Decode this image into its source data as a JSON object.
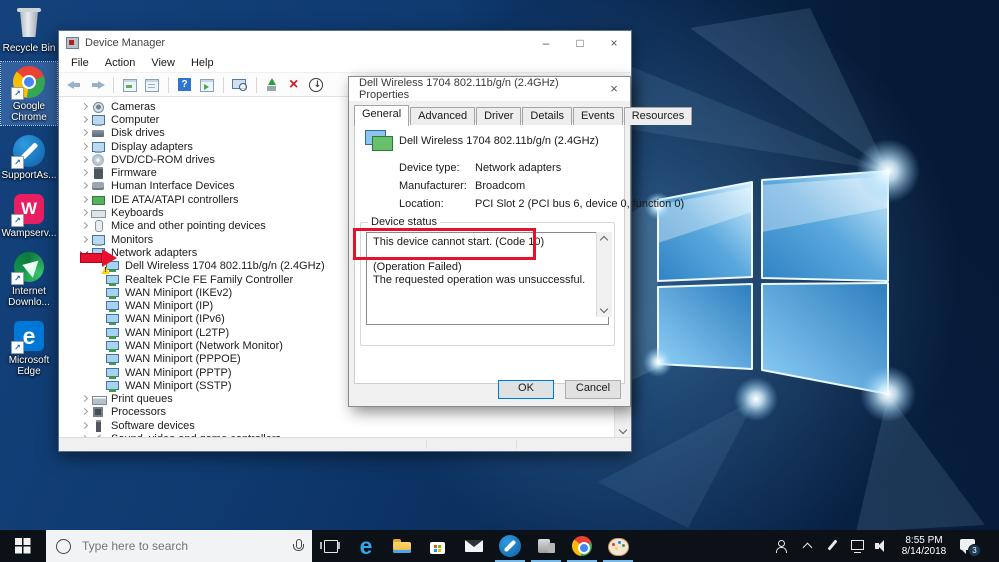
{
  "desktop": {
    "icons": [
      {
        "name": "recycle-bin",
        "label": "Recycle Bin",
        "shortcut": false,
        "selected": false
      },
      {
        "name": "google-chrome",
        "label": "Google\nChrome",
        "shortcut": true,
        "selected": true
      },
      {
        "name": "supportassist",
        "label": "SupportAs...",
        "shortcut": true,
        "selected": false
      },
      {
        "name": "wampserver",
        "label": "Wampserv...",
        "shortcut": true,
        "selected": false
      },
      {
        "name": "idm",
        "label": "Internet\nDownlo...",
        "shortcut": true,
        "selected": false
      },
      {
        "name": "microsoft-edge",
        "label": "Microsoft\nEdge",
        "shortcut": true,
        "selected": false
      }
    ]
  },
  "device_manager": {
    "title": "Device Manager",
    "menu": [
      "File",
      "Action",
      "View",
      "Help"
    ],
    "toolbar": [
      "back",
      "forward",
      "|",
      "console-window",
      "properties",
      "|",
      "help",
      "action-pane",
      "|",
      "scan-hardware",
      "|",
      "update-driver",
      "uninstall",
      "disable-device"
    ],
    "tree": [
      {
        "label": "Cameras",
        "level": 0,
        "chevron": "collapsed",
        "icon": "camera"
      },
      {
        "label": "Computer",
        "level": 0,
        "chevron": "collapsed",
        "icon": "computer"
      },
      {
        "label": "Disk drives",
        "level": 0,
        "chevron": "collapsed",
        "icon": "disk"
      },
      {
        "label": "Display adapters",
        "level": 0,
        "chevron": "collapsed",
        "icon": "display"
      },
      {
        "label": "DVD/CD-ROM drives",
        "level": 0,
        "chevron": "collapsed",
        "icon": "dvd"
      },
      {
        "label": "Firmware",
        "level": 0,
        "chevron": "collapsed",
        "icon": "firmware"
      },
      {
        "label": "Human Interface Devices",
        "level": 0,
        "chevron": "collapsed",
        "icon": "hid"
      },
      {
        "label": "IDE ATA/ATAPI controllers",
        "level": 0,
        "chevron": "collapsed",
        "icon": "ide"
      },
      {
        "label": "Keyboards",
        "level": 0,
        "chevron": "collapsed",
        "icon": "keyboard"
      },
      {
        "label": "Mice and other pointing devices",
        "level": 0,
        "chevron": "collapsed",
        "icon": "mouse"
      },
      {
        "label": "Monitors",
        "level": 0,
        "chevron": "collapsed",
        "icon": "monitor"
      },
      {
        "label": "Network adapters",
        "level": 0,
        "chevron": "expanded",
        "icon": "network"
      },
      {
        "label": "Dell Wireless 1704 802.11b/g/n (2.4GHz)",
        "level": 1,
        "icon": "network",
        "warning": true
      },
      {
        "label": "Realtek PCIe FE Family Controller",
        "level": 1,
        "icon": "network"
      },
      {
        "label": "WAN Miniport (IKEv2)",
        "level": 1,
        "icon": "network"
      },
      {
        "label": "WAN Miniport (IP)",
        "level": 1,
        "icon": "network"
      },
      {
        "label": "WAN Miniport (IPv6)",
        "level": 1,
        "icon": "network"
      },
      {
        "label": "WAN Miniport (L2TP)",
        "level": 1,
        "icon": "network"
      },
      {
        "label": "WAN Miniport (Network Monitor)",
        "level": 1,
        "icon": "network"
      },
      {
        "label": "WAN Miniport (PPPOE)",
        "level": 1,
        "icon": "network"
      },
      {
        "label": "WAN Miniport (PPTP)",
        "level": 1,
        "icon": "network"
      },
      {
        "label": "WAN Miniport (SSTP)",
        "level": 1,
        "icon": "network"
      },
      {
        "label": "Print queues",
        "level": 0,
        "chevron": "collapsed",
        "icon": "printer"
      },
      {
        "label": "Processors",
        "level": 0,
        "chevron": "collapsed",
        "icon": "processor"
      },
      {
        "label": "Software devices",
        "level": 0,
        "chevron": "collapsed",
        "icon": "software"
      },
      {
        "label": "Sound, video and game controllers",
        "level": 0,
        "chevron": "collapsed",
        "icon": "sound"
      }
    ]
  },
  "dialog": {
    "title": "Dell Wireless 1704 802.11b/g/n (2.4GHz) Properties",
    "tabs": [
      "General",
      "Advanced",
      "Driver",
      "Details",
      "Events",
      "Resources"
    ],
    "active_tab": "General",
    "device_name": "Dell Wireless 1704 802.11b/g/n (2.4GHz)",
    "fields": [
      {
        "label": "Device type:",
        "value": "Network adapters"
      },
      {
        "label": "Manufacturer:",
        "value": "Broadcom"
      },
      {
        "label": "Location:",
        "value": "PCI Slot 2 (PCI bus 6, device 0, function 0)"
      }
    ],
    "status_group": "Device status",
    "status_text": "This device cannot start. (Code 10)\n\n(Operation Failed)\nThe requested operation was unsuccessful.",
    "buttons": {
      "ok": "OK",
      "cancel": "Cancel"
    }
  },
  "taskbar": {
    "search_placeholder": "Type here to search",
    "buttons": [
      {
        "name": "task-view",
        "running": false
      },
      {
        "name": "edge",
        "running": false
      },
      {
        "name": "file-explorer",
        "running": false
      },
      {
        "name": "store",
        "running": false
      },
      {
        "name": "mail",
        "running": false
      },
      {
        "name": "supportassist",
        "running": true
      },
      {
        "name": "system-tool",
        "running": true
      },
      {
        "name": "chrome",
        "running": true
      },
      {
        "name": "paint",
        "running": true
      }
    ],
    "tray": {
      "time": "8:55 PM",
      "date": "8/14/2018",
      "notification_badge": "3"
    }
  },
  "annotations": {
    "highlighted_text": "This device cannot start. (Code 10)",
    "arrow_target": "Dell Wireless 1704 802.11b/g/n (2.4GHz)",
    "color": "#e8112d"
  },
  "colors": {
    "accent": "#0078d7",
    "warning": "#fcd116",
    "taskbar_bg": "#0c1118"
  }
}
